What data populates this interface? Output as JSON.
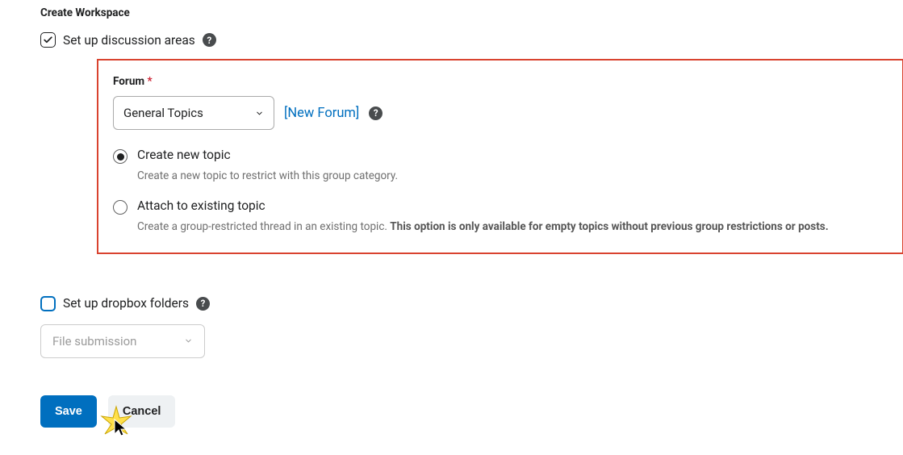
{
  "section_title": "Create Workspace",
  "discussion": {
    "checkbox_label": "Set up discussion areas",
    "checked": true,
    "forum_label": "Forum",
    "forum_selected": "General Topics",
    "new_forum_link": "[New Forum]",
    "option_create": {
      "title": "Create new topic",
      "desc": "Create a new topic to restrict with this group category."
    },
    "option_attach": {
      "title": "Attach to existing topic",
      "desc_plain": "Create a group-restricted thread in an existing topic. ",
      "desc_bold": "This option is only available for empty topics without previous group restrictions or posts."
    }
  },
  "dropbox": {
    "checkbox_label": "Set up dropbox folders",
    "checked": false,
    "select_placeholder": "File submission"
  },
  "buttons": {
    "save": "Save",
    "cancel": "Cancel"
  },
  "glyphs": {
    "help": "?"
  }
}
